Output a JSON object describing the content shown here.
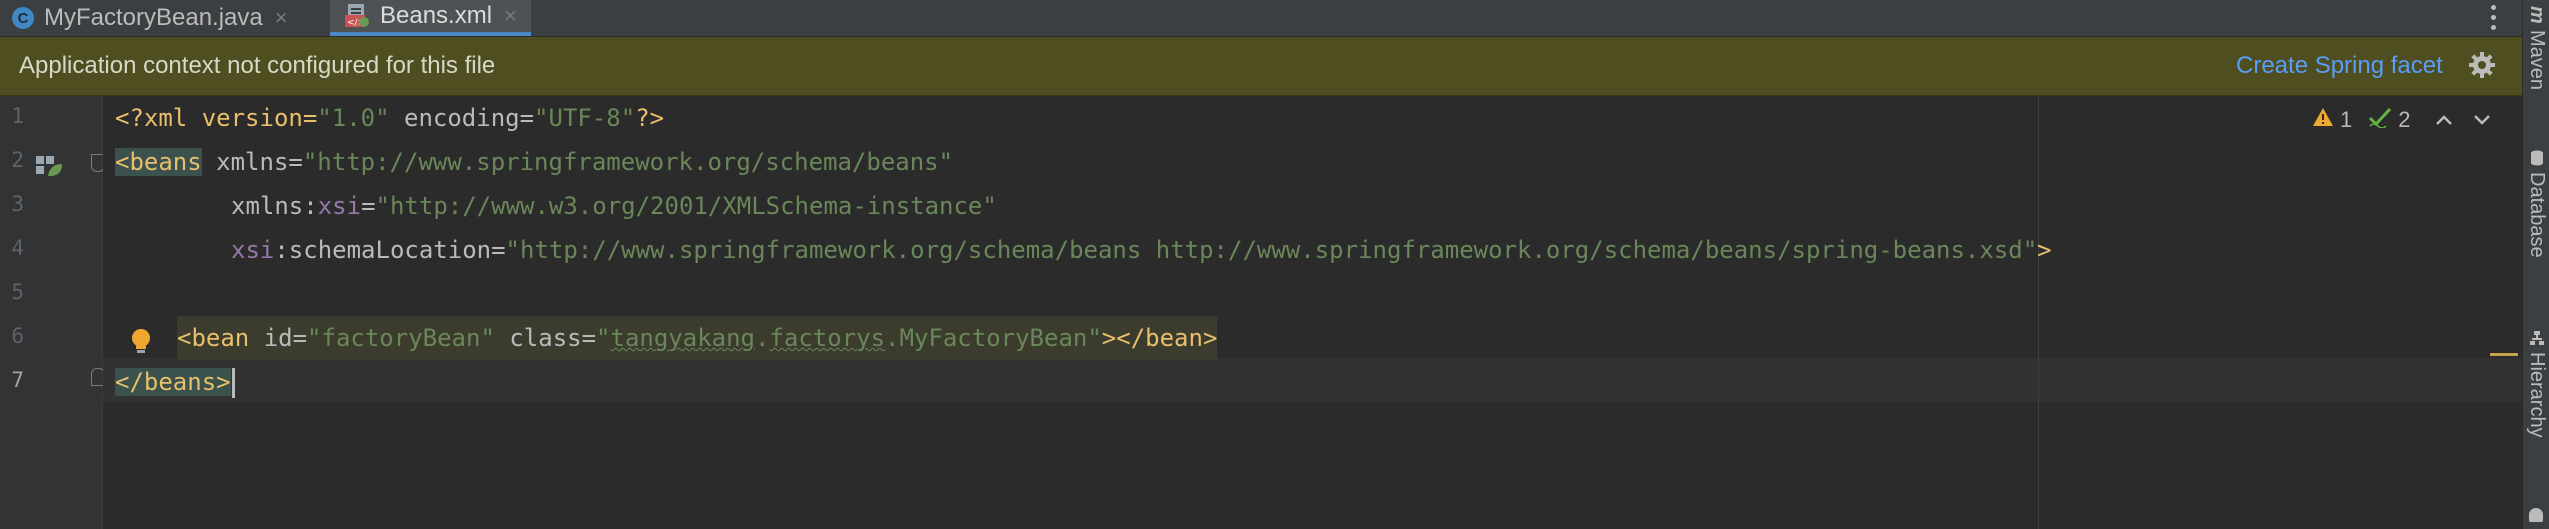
{
  "tabs": [
    {
      "label": "MyFactoryBean.java",
      "icon": "java-class-icon",
      "active": false
    },
    {
      "label": "Beans.xml",
      "icon": "spring-xml-icon",
      "active": true
    }
  ],
  "banner": {
    "message": "Application context not configured for this file",
    "action_label": "Create Spring facet"
  },
  "right_tools": [
    "Maven",
    "Database",
    "Hierarchy"
  ],
  "inspections": {
    "warnings": "1",
    "weak_warnings": "2"
  },
  "line_numbers": [
    "1",
    "2",
    "3",
    "4",
    "5",
    "6",
    "7"
  ],
  "code": {
    "l1": {
      "open": "<?xml version=",
      "v1": "\"1.0\"",
      "mid": " encoding=",
      "v2": "\"UTF-8\"",
      "close": "?>"
    },
    "l2": {
      "tag": "<beans",
      "attr": " xmlns=",
      "val": "\"http://www.springframework.org/schema/beans\""
    },
    "l3": {
      "pre": "xmlns:",
      "ns": "xsi",
      "eq": "=",
      "val": "\"http://www.w3.org/2001/XMLSchema-instance\""
    },
    "l4": {
      "ns": "xsi",
      "attr": ":schemaLocation=",
      "val": "\"http://www.springframework.org/schema/beans http://www.springframework.org/schema/beans/spring-beans.xsd\"",
      "close": ">"
    },
    "l6": {
      "tag": "<bean",
      "attr1": " id=",
      "v1": "\"factoryBean\"",
      "attr2": " class=",
      "q1": "\"",
      "pkg1": "tangyakang",
      "dot1": ".",
      "pkg2": "factorys",
      "dot2": ".",
      "cls": "MyFactoryBean",
      "q2": "\"",
      "close": "></bean>"
    },
    "l7": {
      "tag": "</beans>"
    }
  },
  "colors": {
    "banner_bg": "#4f4e21",
    "link": "#589df6",
    "editor_bg": "#2b2b2b",
    "tag": "#e8bf6a",
    "string": "#6a8759",
    "namespace": "#9876aa"
  }
}
